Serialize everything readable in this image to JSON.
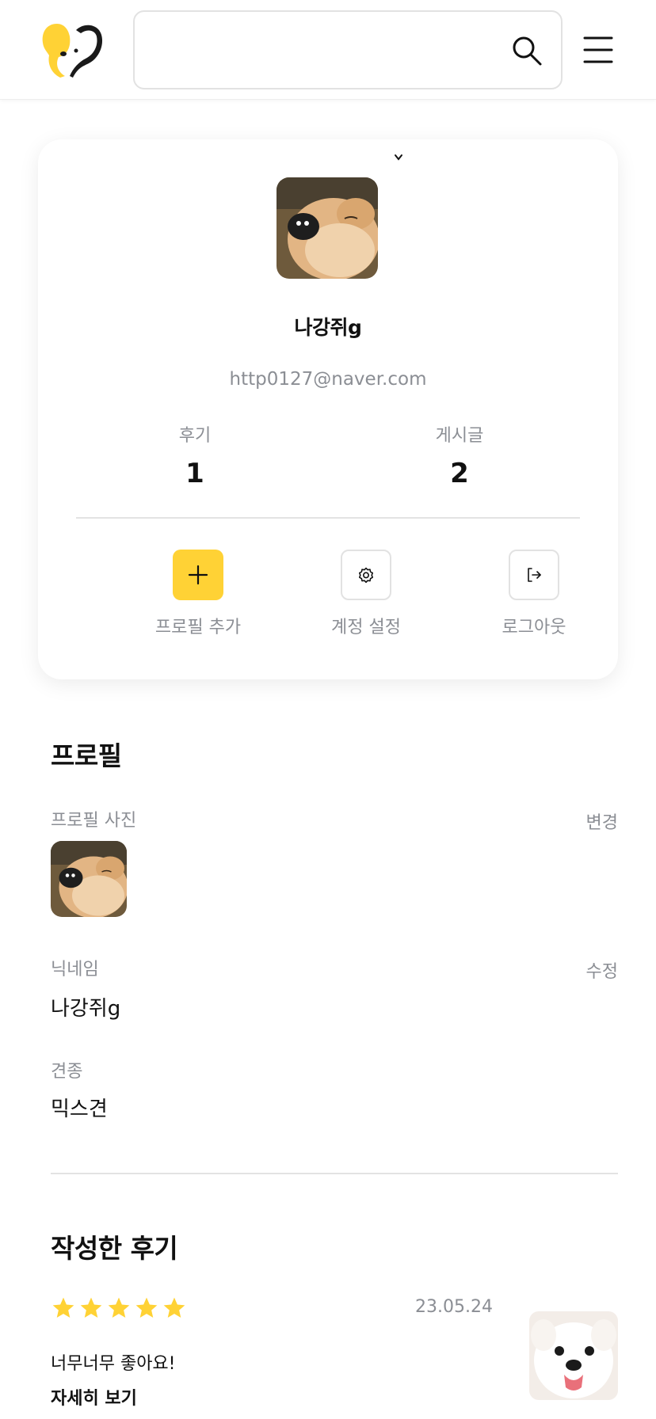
{
  "header": {
    "logo_icon": "mascot-logo-icon",
    "search": {
      "value": "",
      "icon": "search-icon"
    },
    "menu_icon": "hamburger-menu-icon"
  },
  "profile_card": {
    "nickname": "나강쥐g",
    "email": "http0127@naver.com",
    "stats": [
      {
        "label": "후기",
        "value": "1"
      },
      {
        "label": "게시글",
        "value": "2"
      }
    ],
    "actions": [
      {
        "label": "프로필 추가",
        "icon": "plus-icon"
      },
      {
        "label": "계정 설정",
        "icon": "gear-icon"
      },
      {
        "label": "로그아웃",
        "icon": "logout-icon"
      }
    ]
  },
  "profile_section": {
    "title": "프로필",
    "photo_label": "프로필 사진",
    "photo_action": "변경",
    "nickname_label": "닉네임",
    "nickname_action": "수정",
    "nickname_value": "나강쥐g",
    "breed_label": "견종",
    "breed_value": "믹스견"
  },
  "reviews_section": {
    "title": "작성한 후기",
    "items": [
      {
        "rating": 5,
        "date": "23.05.24",
        "text": "너무너무 좋아요!",
        "more_label": "자세히 보기"
      }
    ]
  },
  "colors": {
    "accent": "#ffd235",
    "muted_text": "#8b8e94",
    "border": "#e2e2e2"
  }
}
